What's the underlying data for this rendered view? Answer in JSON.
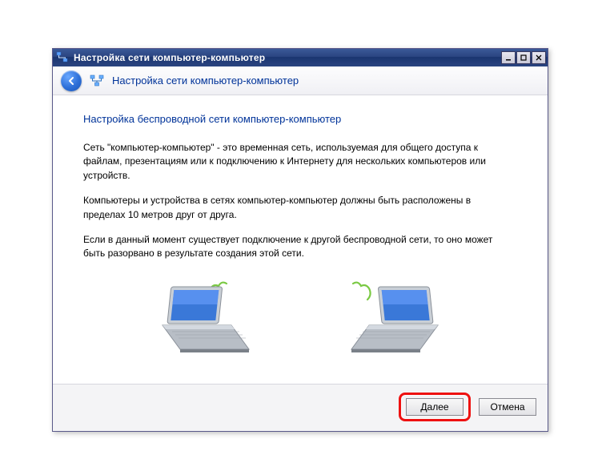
{
  "window": {
    "title": "Настройка сети компьютер-компьютер"
  },
  "header": {
    "title": "Настройка сети компьютер-компьютер"
  },
  "content": {
    "heading": "Настройка беспроводной сети компьютер-компьютер",
    "para1": "Сеть \"компьютер-компьютер\" - это временная сеть, используемая для общего доступа к файлам, презентациям или к подключению к Интернету для нескольких компьютеров или устройств.",
    "para2": "Компьютеры и устройства в сетях компьютер-компьютер должны быть расположены в пределах 10 метров друг от друга.",
    "para3": "Если в данный момент существует подключение к другой беспроводной сети, то оно может быть разорвано в результате создания этой сети."
  },
  "footer": {
    "next_label": "Далее",
    "cancel_label": "Отмена"
  }
}
